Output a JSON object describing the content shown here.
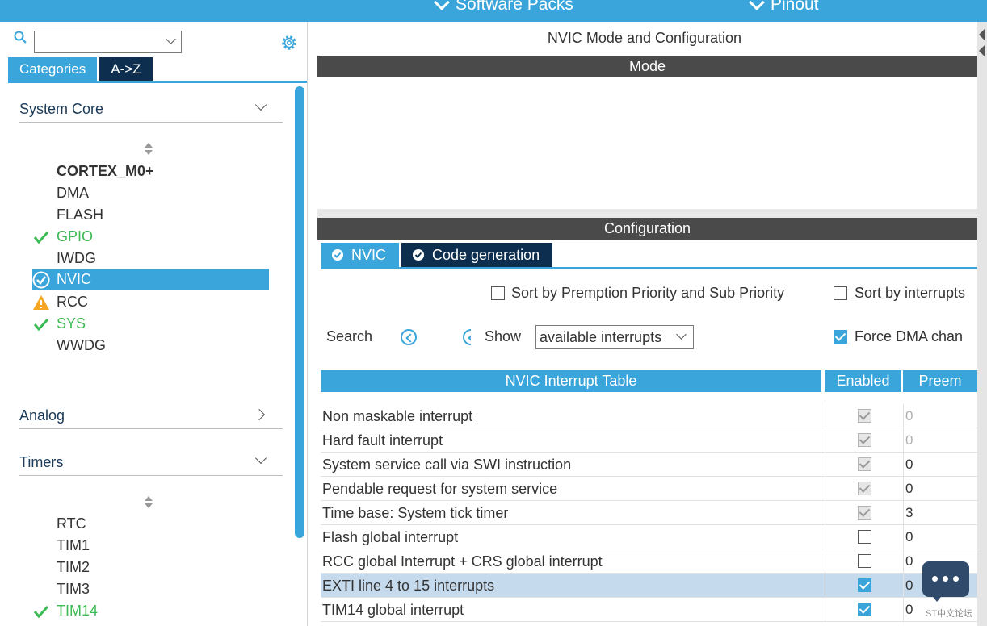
{
  "top_menu": {
    "software_packs": "Software Packs",
    "pinout": "Pinout"
  },
  "left": {
    "tabs": [
      {
        "label": "Categories"
      },
      {
        "label": "A->Z"
      }
    ],
    "sections": [
      {
        "title": "System Core"
      },
      {
        "title": "Analog"
      },
      {
        "title": "Timers"
      }
    ],
    "system_core_items": [
      "CORTEX_M0+",
      "DMA",
      "FLASH",
      "GPIO",
      "IWDG",
      "NVIC",
      "RCC",
      "SYS",
      "WWDG"
    ],
    "timers_items": [
      "RTC",
      "TIM1",
      "TIM2",
      "TIM3",
      "TIM14"
    ]
  },
  "right": {
    "title": "NVIC Mode and Configuration",
    "mode_label": "Mode",
    "config_label": "Configuration",
    "tabs": [
      {
        "label": "NVIC"
      },
      {
        "label": "Code generation"
      }
    ],
    "sort_premption_label": "Sort by Premption Priority and Sub Priority",
    "sort_interrupts_label": "Sort by interrupts",
    "search_label": "Search",
    "show_label": "Show",
    "show_value": "available interrupts",
    "force_dma_label": "Force DMA chan",
    "table": {
      "headers": [
        "NVIC Interrupt Table",
        "Enabled",
        "Preem"
      ],
      "rows": [
        {
          "name": "Non maskable interrupt",
          "enabled": true,
          "locked": true,
          "preempt": "0",
          "preempt_grey": true
        },
        {
          "name": "Hard fault interrupt",
          "enabled": true,
          "locked": true,
          "preempt": "0",
          "preempt_grey": true
        },
        {
          "name": "System service call via SWI instruction",
          "enabled": true,
          "locked": true,
          "preempt": "0",
          "preempt_grey": false
        },
        {
          "name": "Pendable request for system service",
          "enabled": true,
          "locked": true,
          "preempt": "0",
          "preempt_grey": false
        },
        {
          "name": "Time base: System tick timer",
          "enabled": true,
          "locked": true,
          "preempt": "3",
          "preempt_grey": false
        },
        {
          "name": "Flash global interrupt",
          "enabled": false,
          "locked": false,
          "preempt": "0",
          "preempt_grey": false
        },
        {
          "name": "RCC global Interrupt + CRS global interrupt",
          "enabled": false,
          "locked": false,
          "preempt": "0",
          "preempt_grey": false
        },
        {
          "name": "EXTI line 4 to 15 interrupts",
          "enabled": true,
          "locked": false,
          "preempt": "0",
          "preempt_grey": false,
          "selected": true
        },
        {
          "name": "TIM14 global interrupt",
          "enabled": true,
          "locked": false,
          "preempt": "0",
          "preempt_grey": false
        }
      ]
    }
  },
  "badge": {
    "text": "ST中文论坛"
  },
  "colors": {
    "accent": "#3aa5da",
    "dark_tab": "#0d2e4e",
    "ok_green": "#3cba54",
    "warn": "#f5a623"
  }
}
